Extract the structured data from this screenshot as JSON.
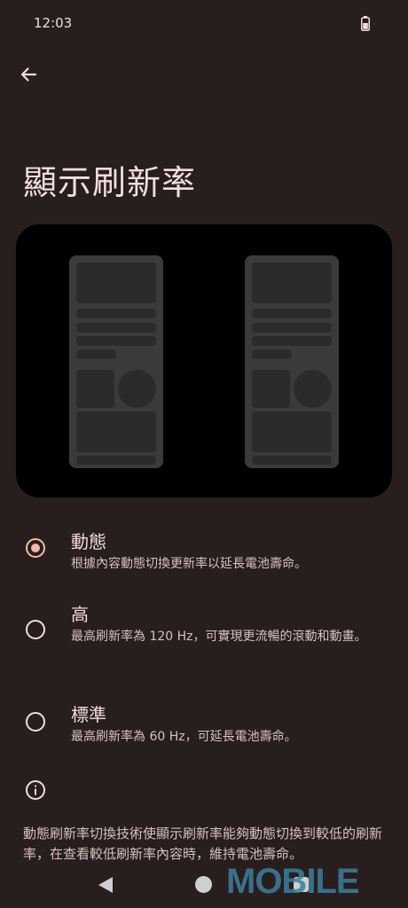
{
  "status_bar": {
    "time": "12:03"
  },
  "header": {
    "title": "顯示刷新率"
  },
  "options": [
    {
      "title": "動態",
      "subtitle": "根據內容動態切換更新率以延長電池壽命。",
      "selected": true
    },
    {
      "title": "高",
      "subtitle": "最高刷新率為 120 Hz，可實現更流暢的滾動和動畫。",
      "selected": false
    },
    {
      "title": "標準",
      "subtitle": "最高刷新率為 60 Hz，可延長電池壽命。",
      "selected": false
    }
  ],
  "footer": {
    "text": "動態刷新率切換技術使顯示刷新率能夠動態切換到較低的刷新率，在查看較低刷新率內容時，維持電池壽命。"
  },
  "watermark": "MOBILE",
  "colors": {
    "background": "#271e1d",
    "accent": "#f5b8ae",
    "text": "#f1dedc"
  },
  "icons": [
    "back-arrow-icon",
    "battery-icon",
    "info-icon",
    "nav-back-icon",
    "nav-home-icon",
    "nav-recent-icon"
  ]
}
